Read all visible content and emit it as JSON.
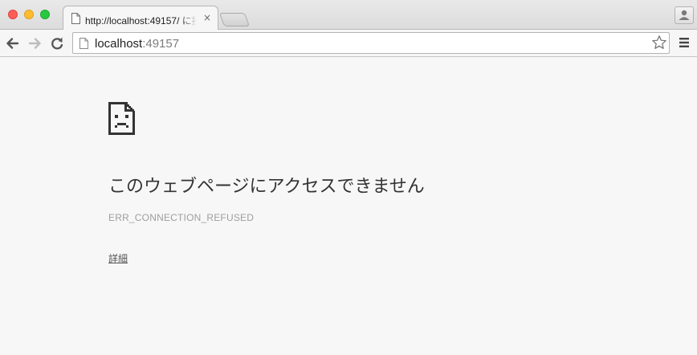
{
  "window": {
    "controls": [
      "close",
      "minimize",
      "maximize"
    ]
  },
  "tab": {
    "title": "http://localhost:49157/ に接",
    "close_glyph": "×",
    "favicon": "page-icon"
  },
  "toolbar": {
    "back_icon": "arrow-left-icon",
    "forward_icon": "arrow-right-icon",
    "reload_icon": "reload-icon",
    "url_host": "localhost",
    "url_port": ":49157",
    "bookmark_icon": "star-icon",
    "menu_icon": "hamburger-icon",
    "profile_icon": "person-icon"
  },
  "error_page": {
    "icon": "sad-page-icon",
    "heading": "このウェブページにアクセスできません",
    "error_code": "ERR_CONNECTION_REFUSED",
    "details_label": "詳細"
  },
  "colors": {
    "background": "#f7f7f7",
    "heading": "#333333",
    "error_code": "#9e9e9e"
  }
}
